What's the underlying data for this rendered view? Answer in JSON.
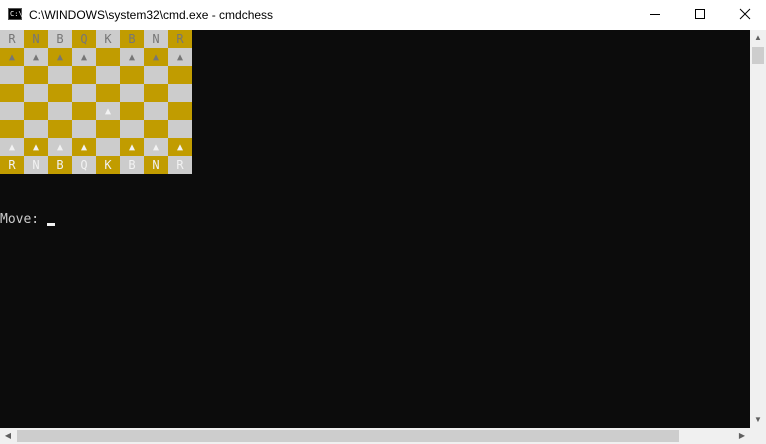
{
  "window": {
    "title": "C:\\WINDOWS\\system32\\cmd.exe - cmdchess",
    "icon": "console-icon",
    "icon_text": "C:\\"
  },
  "controls": {
    "minimize": "minimize-icon",
    "maximize": "maximize-icon",
    "close": "close-icon"
  },
  "colors": {
    "console_bg": "#0c0c0c",
    "light_square": "#cccccc",
    "dark_square": "#c19c00",
    "black_piece": "#767676",
    "white_piece": "#f2f2f2",
    "prompt_text": "#cccccc"
  },
  "board": {
    "rows": [
      [
        {
          "p": "R",
          "c": "b"
        },
        {
          "p": "N",
          "c": "b"
        },
        {
          "p": "B",
          "c": "b"
        },
        {
          "p": "Q",
          "c": "b"
        },
        {
          "p": "K",
          "c": "b"
        },
        {
          "p": "B",
          "c": "b"
        },
        {
          "p": "N",
          "c": "b"
        },
        {
          "p": "R",
          "c": "b"
        }
      ],
      [
        {
          "p": "▲",
          "c": "b"
        },
        {
          "p": "▲",
          "c": "b"
        },
        {
          "p": "▲",
          "c": "b"
        },
        {
          "p": "▲",
          "c": "b"
        },
        {
          "p": "",
          "c": ""
        },
        {
          "p": "▲",
          "c": "b"
        },
        {
          "p": "▲",
          "c": "b"
        },
        {
          "p": "▲",
          "c": "b"
        }
      ],
      [
        {
          "p": "",
          "c": ""
        },
        {
          "p": "",
          "c": ""
        },
        {
          "p": "",
          "c": ""
        },
        {
          "p": "",
          "c": ""
        },
        {
          "p": "",
          "c": ""
        },
        {
          "p": "",
          "c": ""
        },
        {
          "p": "",
          "c": ""
        },
        {
          "p": "",
          "c": ""
        }
      ],
      [
        {
          "p": "",
          "c": ""
        },
        {
          "p": "",
          "c": ""
        },
        {
          "p": "",
          "c": ""
        },
        {
          "p": "",
          "c": ""
        },
        {
          "p": "",
          "c": ""
        },
        {
          "p": "",
          "c": ""
        },
        {
          "p": "",
          "c": ""
        },
        {
          "p": "",
          "c": ""
        }
      ],
      [
        {
          "p": "",
          "c": ""
        },
        {
          "p": "",
          "c": ""
        },
        {
          "p": "",
          "c": ""
        },
        {
          "p": "",
          "c": ""
        },
        {
          "p": "▲",
          "c": "w"
        },
        {
          "p": "",
          "c": ""
        },
        {
          "p": "",
          "c": ""
        },
        {
          "p": "",
          "c": ""
        }
      ],
      [
        {
          "p": "",
          "c": ""
        },
        {
          "p": "",
          "c": ""
        },
        {
          "p": "",
          "c": ""
        },
        {
          "p": "",
          "c": ""
        },
        {
          "p": "",
          "c": ""
        },
        {
          "p": "",
          "c": ""
        },
        {
          "p": "",
          "c": ""
        },
        {
          "p": "",
          "c": ""
        }
      ],
      [
        {
          "p": "▲",
          "c": "w"
        },
        {
          "p": "▲",
          "c": "w"
        },
        {
          "p": "▲",
          "c": "w"
        },
        {
          "p": "▲",
          "c": "w"
        },
        {
          "p": "",
          "c": ""
        },
        {
          "p": "▲",
          "c": "w"
        },
        {
          "p": "▲",
          "c": "w"
        },
        {
          "p": "▲",
          "c": "w"
        }
      ],
      [
        {
          "p": "R",
          "c": "w"
        },
        {
          "p": "N",
          "c": "w"
        },
        {
          "p": "B",
          "c": "w"
        },
        {
          "p": "Q",
          "c": "w"
        },
        {
          "p": "K",
          "c": "w"
        },
        {
          "p": "B",
          "c": "w"
        },
        {
          "p": "N",
          "c": "w"
        },
        {
          "p": "R",
          "c": "w"
        }
      ]
    ]
  },
  "prompt": {
    "label": "Move: "
  },
  "scrollbars": {
    "up": "▲",
    "down": "▼",
    "left": "◀",
    "right": "▶"
  }
}
